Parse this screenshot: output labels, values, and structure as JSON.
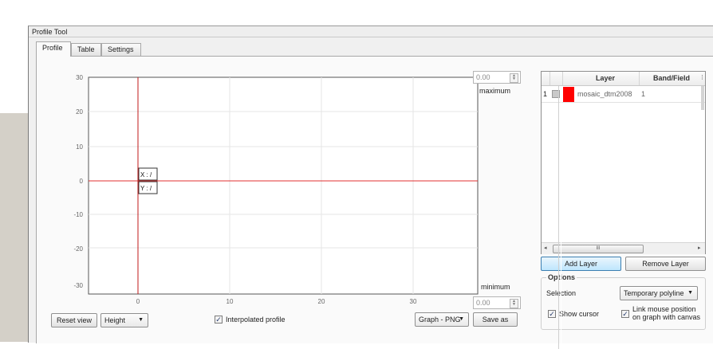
{
  "window": {
    "title": "Profile Tool"
  },
  "tabs": [
    {
      "label": "Profile"
    },
    {
      "label": "Table"
    },
    {
      "label": "Settings"
    }
  ],
  "plot": {
    "y_ticks": [
      "30",
      "20",
      "10",
      "0",
      "-10",
      "-20",
      "-30"
    ],
    "x_ticks": [
      "0",
      "10",
      "20",
      "30"
    ],
    "cursor_x_label": "X : /",
    "cursor_y_label": "Y : /"
  },
  "range": {
    "max_value": "0.00",
    "max_label": "maximum",
    "min_value": "0.00",
    "min_label": "minimum"
  },
  "bottom_bar": {
    "reset_view": "Reset view",
    "mode_select": "Height",
    "interpolated_label": "Interpolated profile",
    "interpolated_checked": true,
    "export_select": "Graph - PNG",
    "save_as": "Save as"
  },
  "layers_table": {
    "headers": [
      "Layer",
      "Band/Field"
    ],
    "rows": [
      {
        "index": "1",
        "color": "#ff0000",
        "layer": "mosaic_dtm2008",
        "band": "1"
      }
    ],
    "scroll_grip": "III"
  },
  "layer_buttons": {
    "add": "Add Layer",
    "remove": "Remove Layer"
  },
  "options": {
    "title": "Options",
    "selection_label": "Selection",
    "selection_value": "Temporary polyline",
    "show_cursor_label": "Show cursor",
    "show_cursor_checked": true,
    "link_mouse_label_1": "Link mouse position",
    "link_mouse_label_2": "on graph with canvas",
    "link_mouse_checked": true
  },
  "colors": {
    "plot_line": "#e03030",
    "accent": "#3c7fb1"
  }
}
